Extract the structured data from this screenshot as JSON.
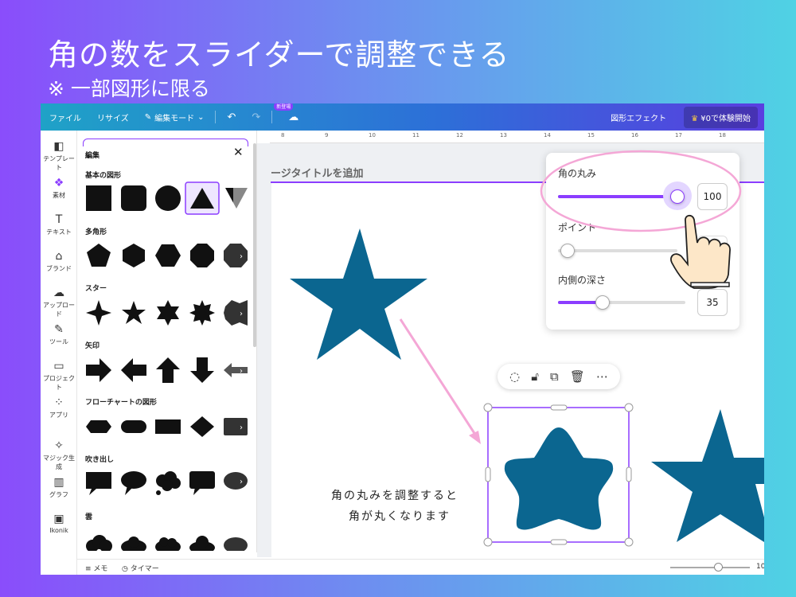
{
  "slide": {
    "title": "角の数をスライダーで調整できる",
    "subtitle": "※ 一部図形に限る"
  },
  "topbar": {
    "file": "ファイル",
    "resize": "リサイズ",
    "edit_mode": "編集モード",
    "new_badge": "新登場",
    "shape_effects": "図形エフェクト",
    "trial": "¥0で体験開始"
  },
  "rail": [
    {
      "label": "テンプレート",
      "icon": "template-icon"
    },
    {
      "label": "素材",
      "icon": "elements-icon"
    },
    {
      "label": "テキスト",
      "icon": "text-icon"
    },
    {
      "label": "ブランド",
      "icon": "brand-icon"
    },
    {
      "label": "アップロード",
      "icon": "upload-icon"
    },
    {
      "label": "ツール",
      "icon": "tools-icon"
    },
    {
      "label": "プロジェクト",
      "icon": "folder-icon"
    },
    {
      "label": "アプリ",
      "icon": "apps-icon"
    },
    {
      "label": "マジック生成",
      "icon": "magic-icon"
    },
    {
      "label": "グラフ",
      "icon": "chart-icon"
    },
    {
      "label": "Ikonik",
      "icon": "ikonik-icon"
    }
  ],
  "panel": {
    "heading": "編集",
    "categories": [
      "基本の図形",
      "多角形",
      "スター",
      "矢印",
      "フローチャートの図形",
      "吹き出し",
      "雲"
    ]
  },
  "ruler": [
    "8",
    "9",
    "10",
    "11",
    "12",
    "13",
    "14",
    "15",
    "16",
    "17",
    "18"
  ],
  "canvas": {
    "page_title": "ージタイトルを追加",
    "annotation_line1": "角の丸みを調整すると",
    "annotation_line2": "角が丸くなります"
  },
  "popover": {
    "roundness_label": "角の丸み",
    "roundness_value": "100",
    "roundness_level": 1.0,
    "points_label": "ポイント",
    "points_level": 0.0,
    "depth_label": "内側の深さ",
    "depth_value": "35",
    "depth_level": 0.35
  },
  "bottombar": {
    "notes": "メモ",
    "timer": "タイマー",
    "zoom": "10"
  },
  "colors": {
    "accent": "#8b3dff",
    "star": "#0b6690",
    "highlight": "#f4a7d6"
  }
}
